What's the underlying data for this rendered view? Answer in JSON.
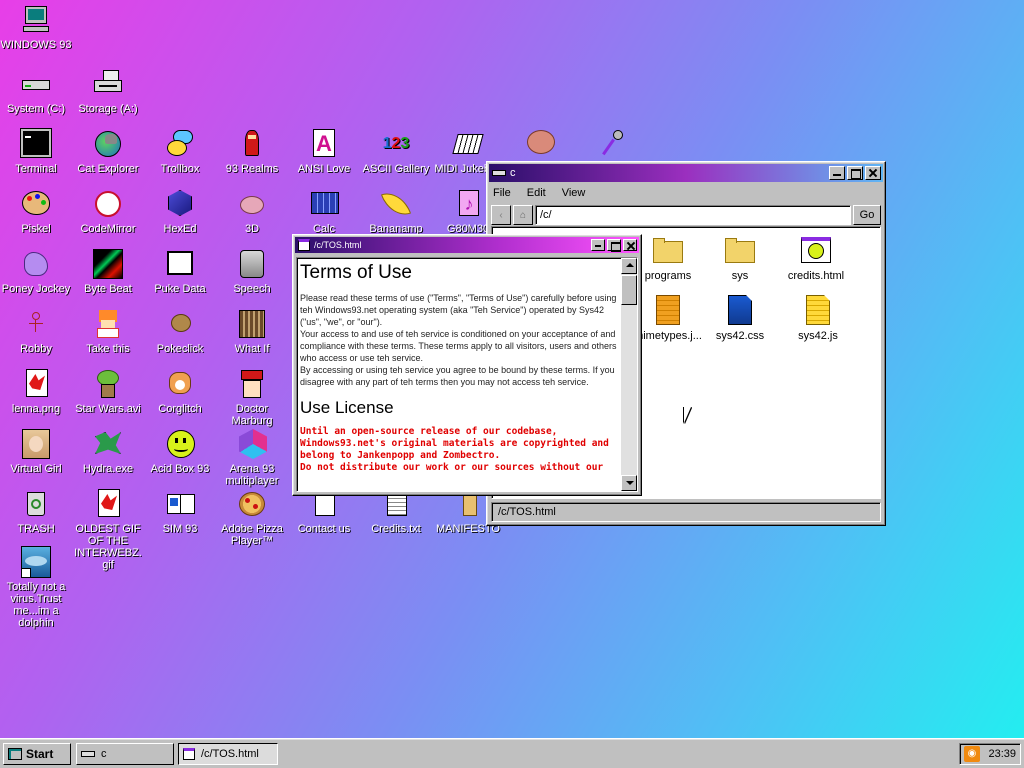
{
  "desktop": {
    "icons": [
      {
        "label": "WINDOWS 93",
        "icon": "computer-icon"
      },
      {
        "label": "System (C:)",
        "icon": "drive-icon"
      },
      {
        "label": "Storage (A:)",
        "icon": "floppy-drive-icon"
      },
      {
        "label": "Terminal",
        "icon": "terminal-icon"
      },
      {
        "label": "Cat Explorer",
        "icon": "cat-globe-icon"
      },
      {
        "label": "Trollbox",
        "icon": "chat-bubble-icon"
      },
      {
        "label": "93 Realms",
        "icon": "knight-icon"
      },
      {
        "label": "ANSI Love",
        "icon": "letter-a-icon"
      },
      {
        "label": "ASCII Gallery",
        "icon": "numbers-icon"
      },
      {
        "label": "MIDI Jukebox",
        "icon": "piano-icon"
      },
      {
        "label": "Piskel",
        "icon": "palette-icon"
      },
      {
        "label": "CodeMirror",
        "icon": "codemirror-icon"
      },
      {
        "label": "HexEd",
        "icon": "cube-icon"
      },
      {
        "label": "3D",
        "icon": "teapot-icon"
      },
      {
        "label": "Calc",
        "icon": "calculator-icon"
      },
      {
        "label": "Bananamp",
        "icon": "banana-icon"
      },
      {
        "label": "G80M30",
        "icon": "music-note-icon"
      },
      {
        "label": "Poney Jockey",
        "icon": "pony-icon"
      },
      {
        "label": "Byte Beat",
        "icon": "waveform-icon"
      },
      {
        "label": "Puke Data",
        "icon": "puredata-icon"
      },
      {
        "label": "Speech",
        "icon": "face-icon"
      },
      {
        "label": "Robby",
        "icon": "stick-figure-icon"
      },
      {
        "label": "Take this",
        "icon": "pixel-man-icon"
      },
      {
        "label": "Pokeclick",
        "icon": "rock-icon"
      },
      {
        "label": "What If",
        "icon": "gate-icon"
      },
      {
        "label": "lenna.png",
        "icon": "image-file-icon"
      },
      {
        "label": "Star Wars.avi",
        "icon": "yoda-icon"
      },
      {
        "label": "Corglitch",
        "icon": "corgi-icon"
      },
      {
        "label": "Doctor Marburg",
        "icon": "doctor-icon"
      },
      {
        "label": "Virtual Girl",
        "icon": "girl-icon"
      },
      {
        "label": "Hydra.exe",
        "icon": "dragon-icon"
      },
      {
        "label": "Acid Box 93",
        "icon": "smiley-icon"
      },
      {
        "label": "Arena 93 multiplayer",
        "icon": "arena-cube-icon"
      },
      {
        "label": "TRASH",
        "icon": "trash-icon"
      },
      {
        "label": "OLDEST GIF OF THE INTERWEBZ.gif",
        "icon": "gif-file-icon"
      },
      {
        "label": "SIM 93",
        "icon": "book-icon"
      },
      {
        "label": "Adobe Pizza Player™",
        "icon": "pizza-icon"
      },
      {
        "label": "Contact us",
        "icon": "contact-icon"
      },
      {
        "label": "Credits.txt",
        "icon": "text-file-icon"
      },
      {
        "label": "MANIFESTO",
        "icon": "manifesto-icon"
      },
      {
        "label": "Totally not a virus.Trust me...im a dolphin",
        "icon": "dolphin-icon"
      }
    ],
    "extra_icons": [
      "cookie-icon",
      "microphone-icon"
    ]
  },
  "explorer": {
    "title": "c",
    "menu": [
      "File",
      "Edit",
      "View"
    ],
    "address": "/c/",
    "go_label": "Go",
    "files": [
      {
        "name": "programs",
        "icon": "folder-icon"
      },
      {
        "name": "sys",
        "icon": "folder-icon"
      },
      {
        "name": "credits.html",
        "icon": "html-file-icon"
      },
      {
        "name": "mimetypes.j...",
        "icon": "js-file-icon"
      },
      {
        "name": "sys42.css",
        "icon": "css-file-icon"
      },
      {
        "name": "sys42.js",
        "icon": "js-file-icon"
      }
    ],
    "status": "/c/TOS.html"
  },
  "tos": {
    "title": "/c/TOS.html",
    "h1": "Terms of Use",
    "p1": "Please read these terms of use (\"Terms\", \"Terms of Use\") carefully before using teh Windows93.net operating system (aka \"Teh Service\") operated by Sys42 (\"us\", \"we\", or \"our\").",
    "p2": "Your access to and use of teh service is conditioned on your acceptance of and compliance with these terms. These terms apply to all visitors, users and others who access or use teh service.",
    "p3": "By accessing or using teh service you agree to be bound by these terms. If you disagree with any part of teh terms then you may not access teh service.",
    "h2": "Use License",
    "p4": "Until an open-source release of our codebase, Windows93.net's original materials are copyrighted and belong to Jankenpopp and Zombectro.",
    "p5": "Do not distribute our work or our sources without our"
  },
  "taskbar": {
    "start_label": "Start",
    "tasks": [
      {
        "label": "c",
        "active": false
      },
      {
        "label": "/c/TOS.html",
        "active": true
      }
    ],
    "clock": "23:39"
  }
}
